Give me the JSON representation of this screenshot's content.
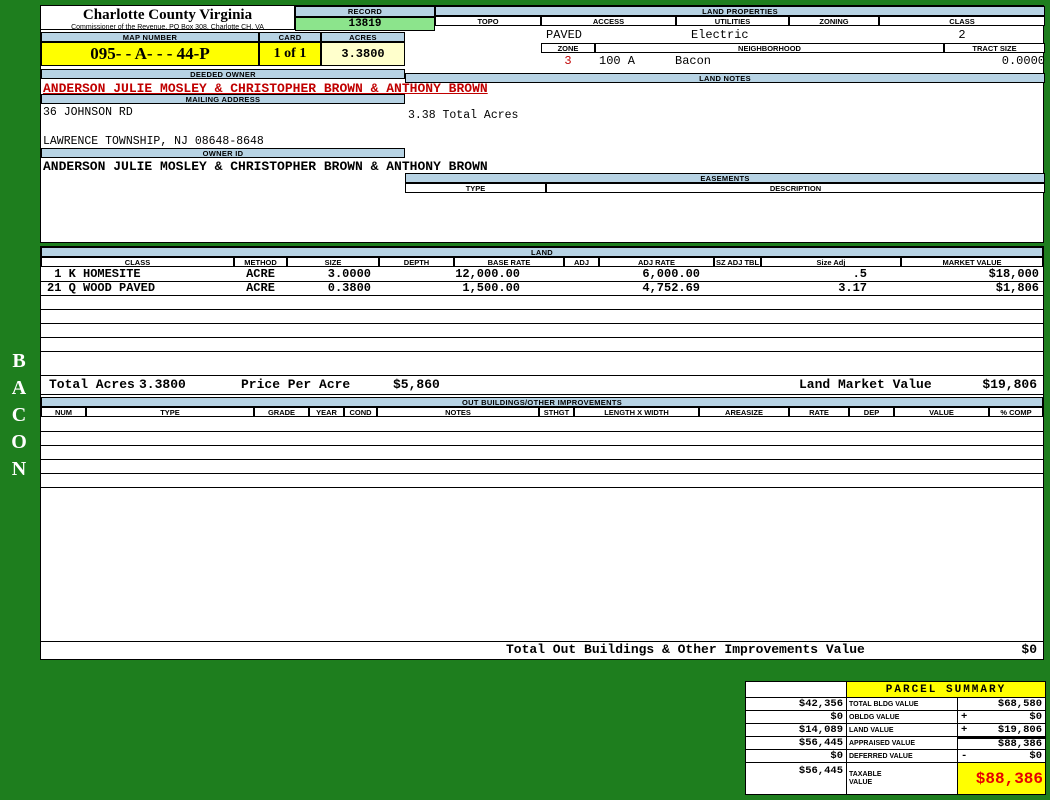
{
  "colors": {
    "background_green": "#1e7e1e",
    "header_blue": "#b7d3e4",
    "record_green": "#8ce48c",
    "highlight_yellow": "#ffff00",
    "acres_cream": "#ffffcc",
    "owner_red": "#c00000",
    "taxable_red": "#e60000"
  },
  "sidebar": {
    "vertical_label": "BACON"
  },
  "header": {
    "county_title": "Charlotte County Virginia",
    "county_subtitle": "Commissioner of the Revenue, PO Box 308, Charlotte CH, VA",
    "record_label": "RECORD",
    "record_value": "13819",
    "map_number_label": "MAP NUMBER",
    "map_number_value": "095- - A- - - 44-P",
    "card_label": "CARD",
    "card_value": "1 of 1",
    "acres_label": "ACRES",
    "acres_value": "3.3800"
  },
  "owner": {
    "deeded_owner_label": "DEEDED OWNER",
    "deeded_owner_value": "ANDERSON JULIE MOSLEY & CHRISTOPHER BROWN & ANTHONY BROWN",
    "mailing_address_label": "MAILING ADDRESS",
    "address_line1": "36 JOHNSON RD",
    "address_line2": "LAWRENCE TOWNSHIP, NJ 08648-8648",
    "owner_id_label": "OWNER ID",
    "owner_id_value": "ANDERSON JULIE MOSLEY & CHRISTOPHER BROWN & ANTHONY BROWN"
  },
  "land_properties": {
    "section_label": "LAND PROPERTIES",
    "columns": [
      "TOPO",
      "ACCESS",
      "UTILITIES",
      "ZONING",
      "CLASS"
    ],
    "access_value": "PAVED",
    "utilities_value": "Electric",
    "class_value": "2",
    "zone_label": "ZONE",
    "neighborhood_label": "NEIGHBORHOOD",
    "tract_size_label": "TRACT SIZE",
    "zone_value": "3",
    "neighborhood_code": "100 A",
    "neighborhood_name": "Bacon",
    "tract_size_value": "0.0000",
    "land_notes_label": "LAND NOTES",
    "land_notes_value": "3.38 Total Acres",
    "easements_label": "EASEMENTS",
    "easements_type_label": "TYPE",
    "easements_description_label": "DESCRIPTION"
  },
  "land_table": {
    "section_label": "LAND",
    "columns": [
      "CLASS",
      "METHOD",
      "SIZE",
      "DEPTH",
      "BASE RATE",
      "ADJ",
      "ADJ RATE",
      "SZ ADJ TBL",
      "Size Adj",
      "MARKET VALUE"
    ],
    "rows": [
      {
        "class": " 1 K HOMESITE",
        "method": "ACRE",
        "size": "3.0000",
        "depth": "",
        "base_rate": "12,000.00",
        "adj": "",
        "adj_rate": "6,000.00",
        "sz_adj_tbl": "",
        "size_adj": ".5",
        "market_value": "$18,000"
      },
      {
        "class": "21 Q WOOD PAVED",
        "method": "ACRE",
        "size": "0.3800",
        "depth": "",
        "base_rate": "1,500.00",
        "adj": "",
        "adj_rate": "4,752.69",
        "sz_adj_tbl": "",
        "size_adj": "3.17",
        "market_value": "$1,806"
      }
    ],
    "totals": {
      "total_acres_label": "Total Acres",
      "total_acres_value": "3.3800",
      "price_per_acre_label": "Price Per Acre",
      "price_per_acre_value": "$5,860",
      "land_market_value_label": "Land Market Value",
      "land_market_value": "$19,806"
    }
  },
  "out_buildings": {
    "section_label": "OUT BUILDINGS/OTHER IMPROVEMENTS",
    "columns": [
      "NUM",
      "TYPE",
      "GRADE",
      "YEAR",
      "COND",
      "NOTES",
      "STHGT",
      "LENGTH X WIDTH",
      "AREASIZE",
      "RATE",
      "DEP",
      "VALUE",
      "% COMP"
    ],
    "total_label": "Total Out Buildings & Other Improvements Value",
    "total_value": "$0"
  },
  "parcel_summary": {
    "title": "PARCEL SUMMARY",
    "rows": [
      {
        "left": "$42,356",
        "label": "TOTAL BLDG VALUE",
        "op": "",
        "right": "$68,580"
      },
      {
        "left": "$0",
        "label": "OBLDG VALUE",
        "op": "+",
        "right": "$0"
      },
      {
        "left": "$14,089",
        "label": "LAND VALUE",
        "op": "+",
        "right": "$19,806"
      },
      {
        "left": "$56,445",
        "label": "APPRAISED VALUE",
        "op": "",
        "right": "$88,386"
      },
      {
        "left": "$0",
        "label": "DEFERRED VALUE",
        "op": "-",
        "right": "$0"
      },
      {
        "left": "$56,445",
        "label": "TAXABLE VALUE",
        "op": "",
        "right": "$88,386"
      }
    ]
  }
}
